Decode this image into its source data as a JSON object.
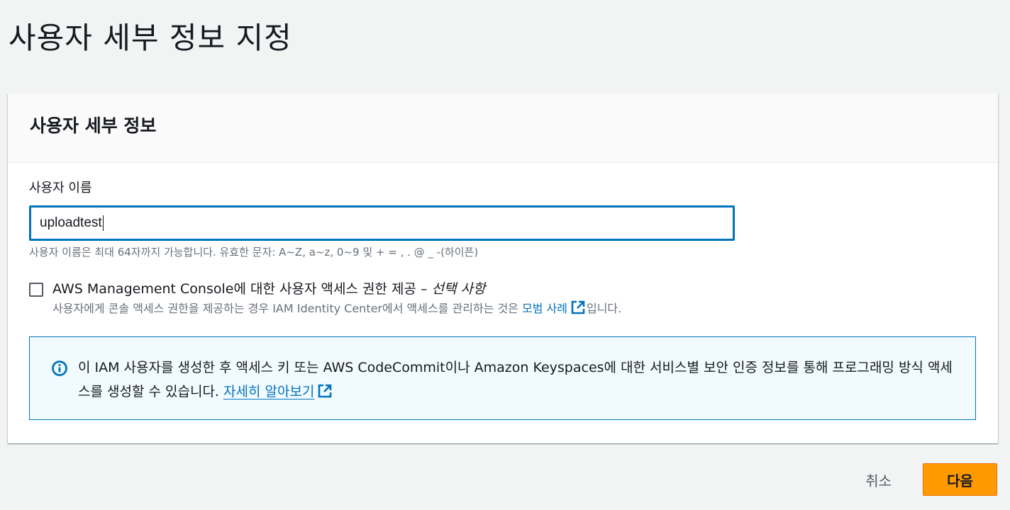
{
  "page": {
    "title": "사용자 세부 정보 지정"
  },
  "panel": {
    "title": "사용자 세부 정보",
    "username": {
      "label": "사용자 이름",
      "value": "uploadtest",
      "constraint": "사용자 이름은 최대 64자까지 가능합니다. 유효한 문자: A~Z, a~z, 0~9 및 + = , . @ _ -(하이픈)"
    },
    "console_access": {
      "checked": false,
      "label": "AWS Management Console에 대한 사용자 액세스 권한 제공 – ",
      "optional": "선택 사항",
      "desc_prefix": "사용자에게 콘솔 액세스 권한을 제공하는 경우 IAM Identity Center에서 액세스를 관리하는 것은 ",
      "desc_link": "모범 사례",
      "desc_suffix": "입니다."
    },
    "info": {
      "icon": "info-icon",
      "text": "이 IAM 사용자를 생성한 후 액세스 키 또는 AWS CodeCommit이나 Amazon Keyspaces에 대한 서비스별 보안 인증 정보를 통해 프로그래밍 방식 액세스를 생성할 수 있습니다. ",
      "link": "자세히 알아보기"
    }
  },
  "footer": {
    "cancel": "취소",
    "next": "다음"
  },
  "colors": {
    "accent": "#0073bb",
    "primary_button": "#ff9900",
    "info_bg": "#f1faff"
  }
}
